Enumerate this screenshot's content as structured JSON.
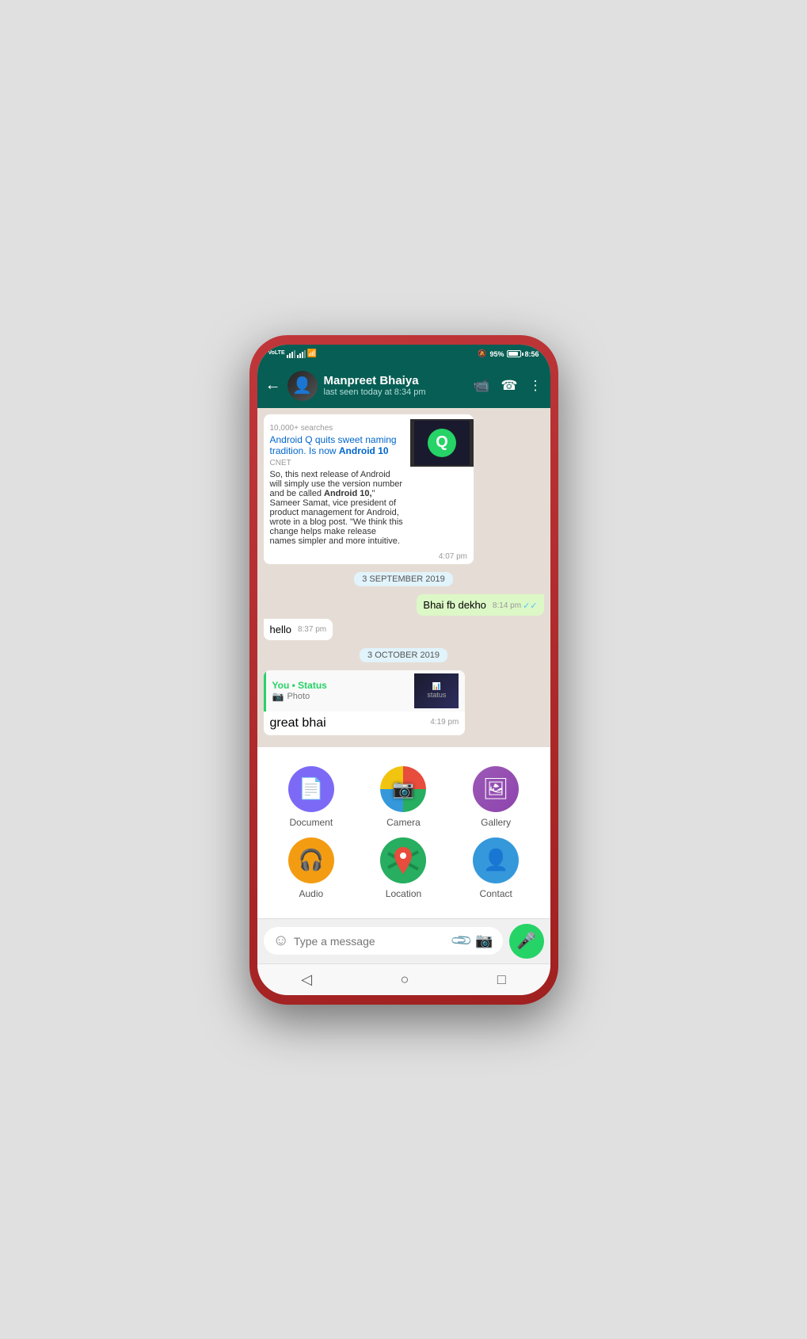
{
  "statusBar": {
    "carrier": "VoLTE",
    "signal": "signal",
    "wifi": "wifi",
    "mute": "🔕",
    "battery": "95%",
    "time": "8:56"
  },
  "header": {
    "contactName": "Manpreet Bhaiya",
    "lastSeen": "last seen today at 8:34 pm",
    "backLabel": "←"
  },
  "chat": {
    "messages": [
      {
        "type": "link",
        "time": "4:07 pm",
        "title": "Android Q quits sweet naming tradition. Is now Android 10",
        "source": "CNET",
        "desc": "So, this next release of Android will simply use the version number and be called Android 10,"
      },
      {
        "type": "date",
        "label": "3 SEPTEMBER 2019"
      },
      {
        "type": "sent",
        "text": "Bhai fb dekho",
        "time": "8:14 pm",
        "ticks": "✓✓"
      },
      {
        "type": "received",
        "text": "hello",
        "time": "8:37 pm"
      },
      {
        "type": "date",
        "label": "3 OCTOBER 2019"
      },
      {
        "type": "status",
        "sender": "You • Status",
        "sub": "Photo",
        "text": "great bhai",
        "time": "4:19 pm"
      }
    ]
  },
  "attachmentSheet": {
    "items": [
      {
        "id": "document",
        "label": "Document",
        "icon": "📄",
        "color": "#7c6af7"
      },
      {
        "id": "camera",
        "label": "Camera",
        "icon": "📷",
        "color": "multi"
      },
      {
        "id": "gallery",
        "label": "Gallery",
        "icon": "🖼",
        "color": "#9b59b6"
      },
      {
        "id": "audio",
        "label": "Audio",
        "icon": "🎧",
        "color": "#f39c12"
      },
      {
        "id": "location",
        "label": "Location",
        "icon": "📍",
        "color": "#27ae60"
      },
      {
        "id": "contact",
        "label": "Contact",
        "icon": "👤",
        "color": "#3498db"
      }
    ]
  },
  "messageBar": {
    "placeholder": "Type a message"
  },
  "navBar": {
    "back": "◁",
    "home": "○",
    "recents": "□"
  }
}
